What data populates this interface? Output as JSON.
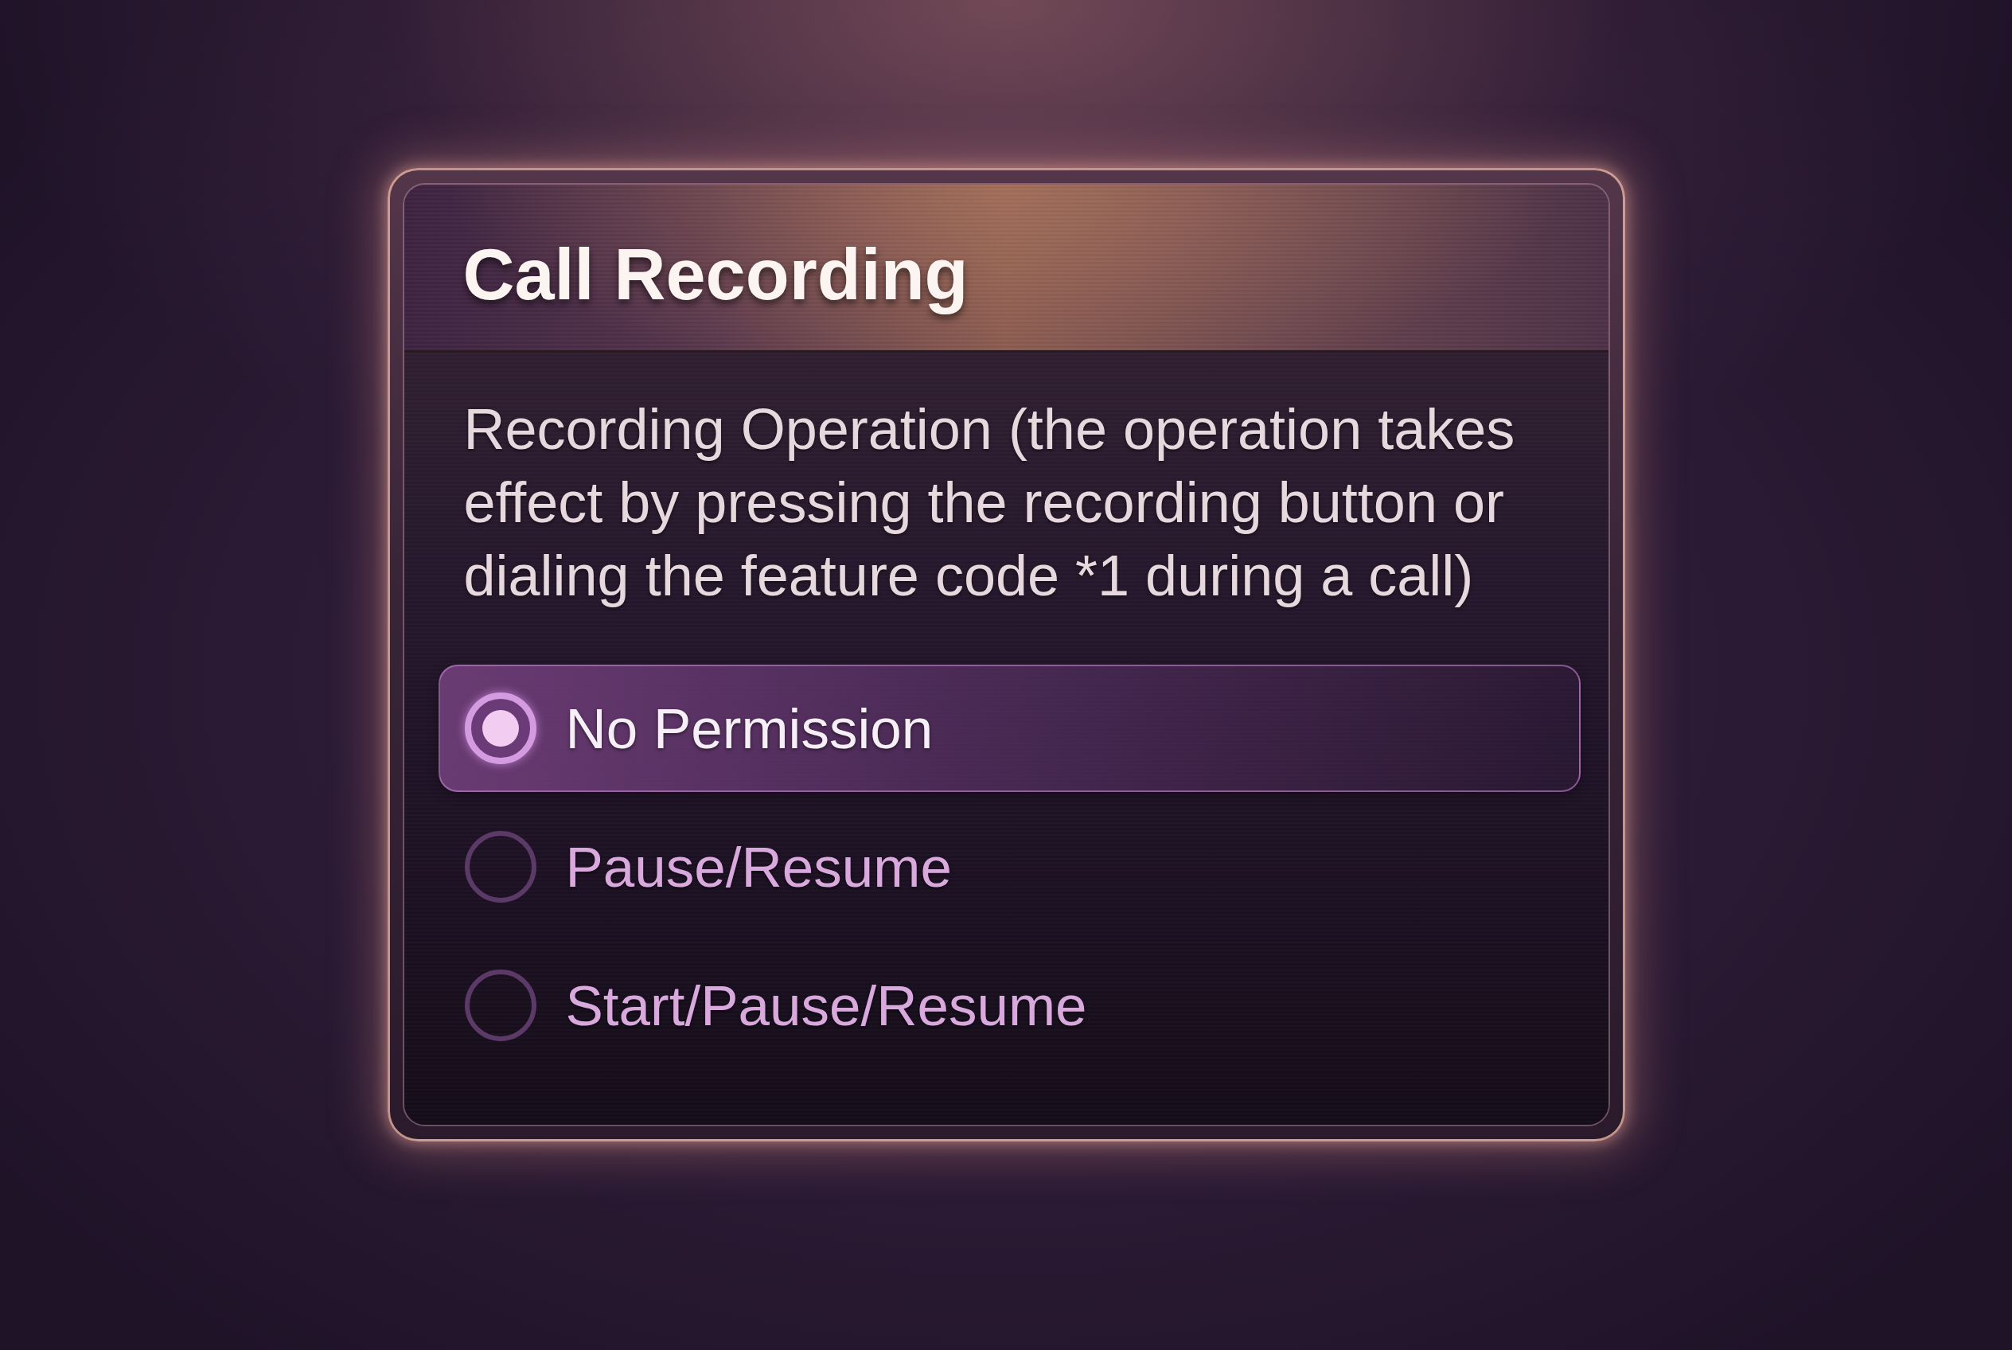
{
  "dialog": {
    "title": "Call Recording",
    "description": "Recording Operation (the operation takes effect by pressing the recording button or dialing the feature code *1 during a call)",
    "options": [
      {
        "label": "No Permission",
        "selected": true
      },
      {
        "label": "Pause/Resume",
        "selected": false
      },
      {
        "label": "Start/Pause/Resume",
        "selected": false
      }
    ]
  }
}
